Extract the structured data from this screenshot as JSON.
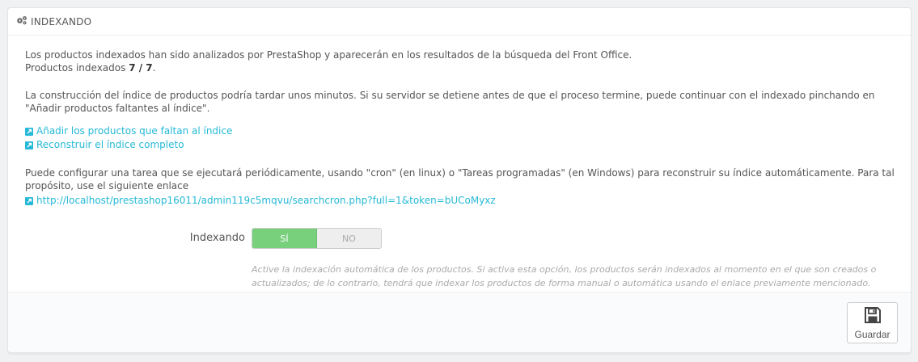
{
  "panel": {
    "title": "INDEXANDO",
    "title_icon": "gears-icon"
  },
  "info": {
    "intro": "Los productos indexados han sido analizados por PrestaShop y aparecerán en los resultados de la búsqueda del Front Office.",
    "indexed_label": "Productos indexados",
    "indexed_count": "7 / 7",
    "indexed_suffix": ".",
    "rebuild_note": "La construcción del índice de productos podría tardar unos minutos. Si su servidor se detiene antes de que el proceso termine, puede continuar con el indexado pinchando en \"Añadir productos faltantes al índice\"."
  },
  "links": {
    "add_missing": "Añadir los productos que faltan al índice",
    "rebuild_all": "Reconstruir el índice completo",
    "icon": "external-link-icon"
  },
  "cron": {
    "note": "Puede configurar una tarea que se ejecutará periódicamente, usando \"cron\" (en linux) o \"Tareas programadas\" (en Windows) para reconstruir su índice automáticamente. Para tal propósito, use el siguiente enlace",
    "url": "http://localhost/prestashop16011/admin119c5mqvu/searchcron.php?full=1&token=bUCoMyxz"
  },
  "indexing_field": {
    "label": "Indexando",
    "yes": "SÍ",
    "no": "NO",
    "selected": "SÍ",
    "help": "Active la indexación automática de los productos. Si activa esta opción, los productos serán indexados al momento en el que son creados o actualizados; de lo contrario, tendrá que indexar los productos de forma manual o automática usando el enlace previamente mencionado."
  },
  "footer": {
    "save_label": "Guardar",
    "save_icon": "save-icon"
  },
  "colors": {
    "link": "#25b9d7",
    "switch_on": "#78d07d"
  }
}
